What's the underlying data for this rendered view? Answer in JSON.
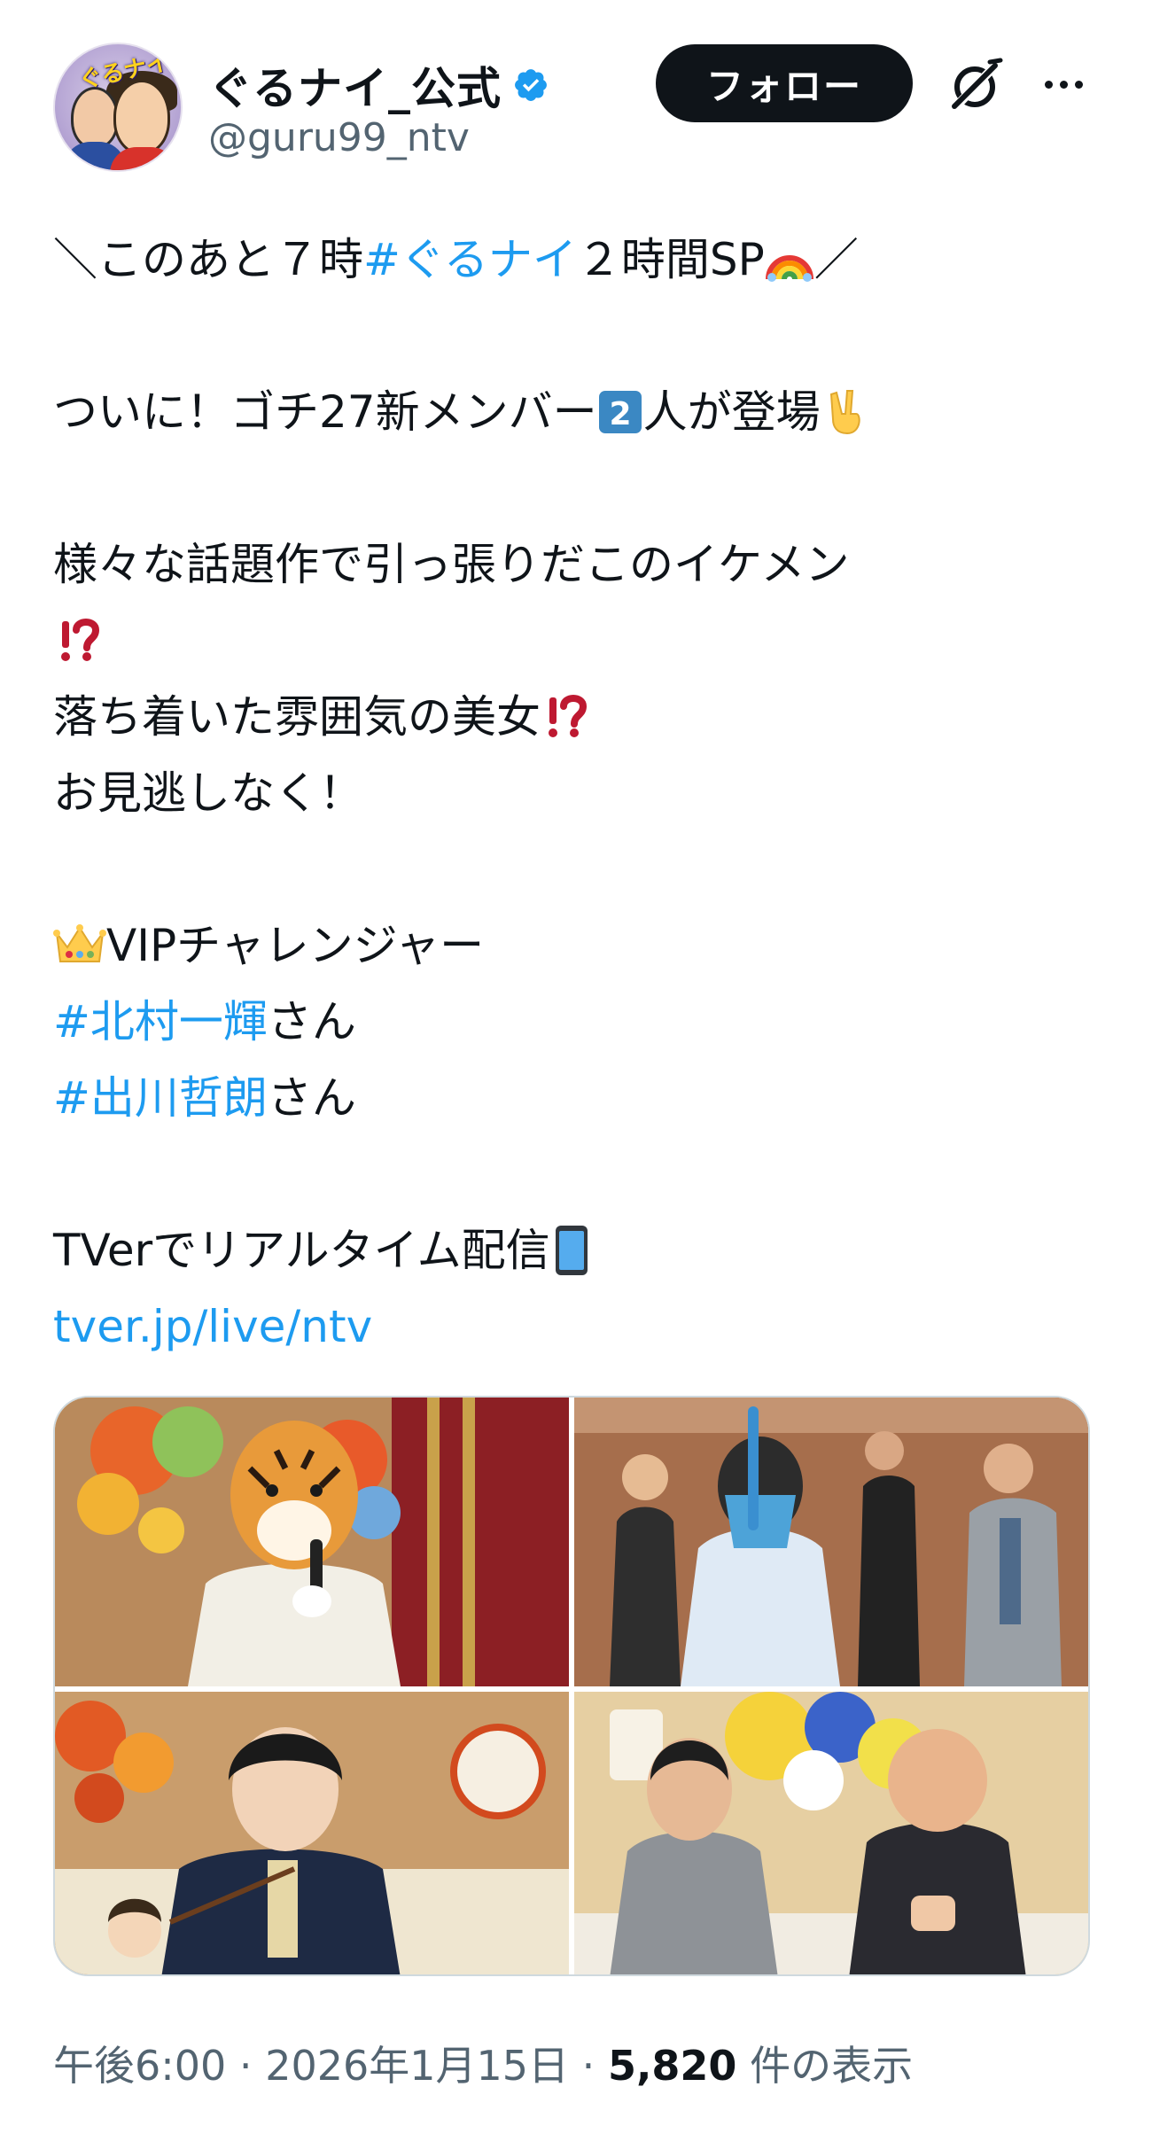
{
  "account": {
    "display_name": "ぐるナイ_公式",
    "handle": "@guru99_ntv",
    "avatar_logo_text": "ぐるナイ",
    "follow_label": "フォロー"
  },
  "tweet": {
    "l1_pre": "＼このあと７時 ",
    "l1_tag": "#ぐるナイ",
    "l1_post": " ２時間SP",
    "l1_end": "／",
    "l2_pre": "ついに！ゴチ27新メンバー",
    "l2_post": "人が登場",
    "l3": "様々な話題作で引っ張りだこのイケメン",
    "l5": "落ち着いた雰囲気の美女",
    "l6": "お見逃しなく！",
    "l7": "VIPチャレンジャー",
    "l8_tag": "#北村一輝",
    "l8_post": " さん",
    "l9_tag": "#出川哲朗",
    "l9_post": " さん",
    "l10": "TVerでリアルタイム配信",
    "l11_link": "tver.jp/live/ntv"
  },
  "meta": {
    "time": "午後6:00",
    "sep1": " · ",
    "date": "2026年1月15日",
    "sep2": " · ",
    "views_count": "5,820",
    "views_label": " 件の表示"
  },
  "colors": {
    "link": "#1d9bf0",
    "text": "#0f1419",
    "muted": "#536471",
    "verified": "#1d9bf0"
  }
}
